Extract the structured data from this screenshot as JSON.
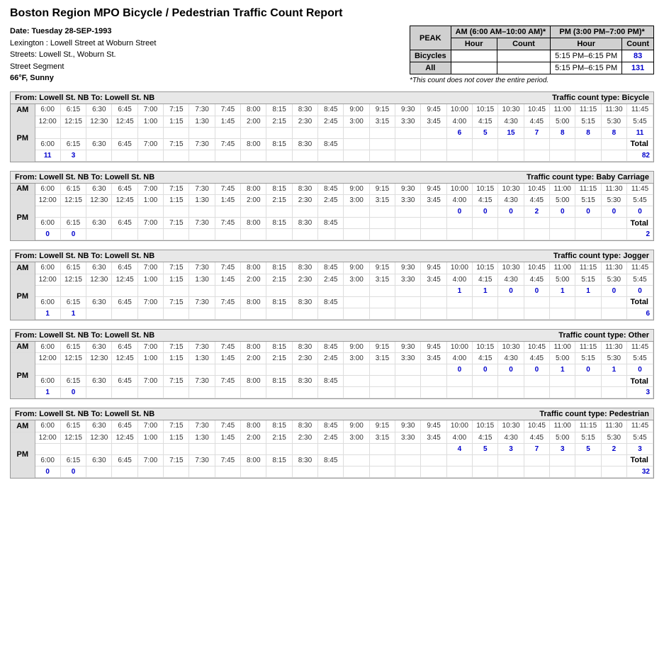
{
  "title": "Boston Region MPO Bicycle / Pedestrian Traffic Count Report",
  "header": {
    "date_label": "Date: Tuesday 28-SEP-1993",
    "location1": "Lexington : Lowell Street at Woburn Street",
    "location2": "Streets: Lowell St., Woburn St.",
    "segment": "Street Segment",
    "weather": "66°F, Sunny",
    "peak_label": "PEAK",
    "am_period": "AM (6:00 AM–10:00 AM)*",
    "pm_period": "PM (3:00 PM–7:00 PM)*",
    "hour_label": "Hour",
    "count_label": "Count",
    "bicycles_label": "Bicycles",
    "all_label": "All",
    "am_hour": "",
    "am_count": "",
    "pm_hour_bicycles": "5:15 PM–6:15 PM",
    "pm_count_bicycles": "83",
    "pm_hour_all": "5:15 PM–6:15 PM",
    "pm_count_all": "131",
    "note": "*This count does not cover the entire period."
  },
  "sections": [
    {
      "from": "From:   Lowell St. NB",
      "to": "To:   Lowell St. NB",
      "type": "Traffic count type:   Bicycle",
      "am_times1": [
        "6:00",
        "6:15",
        "6:30",
        "6:45",
        "7:00",
        "7:15",
        "7:30",
        "7:45",
        "8:00",
        "8:15",
        "8:30",
        "8:45",
        "9:00",
        "9:15",
        "9:30",
        "9:45",
        "10:00",
        "10:15",
        "10:30",
        "10:45",
        "11:00",
        "11:15",
        "11:30",
        "11:45"
      ],
      "am_counts1": [
        "",
        "",
        "",
        "",
        "",
        "",
        "",
        "",
        "",
        "",
        "",
        "",
        "",
        "",
        "",
        "",
        "",
        "",
        "",
        "",
        "",
        "",
        "",
        ""
      ],
      "pm_times1": [
        "12:00",
        "12:15",
        "12:30",
        "12:45",
        "1:00",
        "1:15",
        "1:30",
        "1:45",
        "2:00",
        "2:15",
        "2:30",
        "2:45",
        "3:00",
        "3:15",
        "3:30",
        "3:45",
        "4:00",
        "4:15",
        "4:30",
        "4:45",
        "5:00",
        "5:15",
        "5:30",
        "5:45"
      ],
      "pm_counts1": [
        "",
        "",
        "",
        "",
        "",
        "",
        "",
        "",
        "",
        "",
        "",
        "",
        "",
        "",
        "",
        "",
        "6",
        "5",
        "15",
        "7",
        "8",
        "8",
        "8",
        "11"
      ],
      "pm_times2": [
        "6:00",
        "6:15",
        "6:30",
        "6:45",
        "7:00",
        "7:15",
        "7:30",
        "7:45",
        "8:00",
        "8:15",
        "8:30",
        "8:45"
      ],
      "pm_counts2": [
        "11",
        "3",
        "",
        "",
        "",
        "",
        "",
        "",
        "",
        "",
        "",
        ""
      ],
      "total": "82"
    },
    {
      "from": "From:   Lowell St. NB",
      "to": "To:   Lowell St. NB",
      "type": "Traffic count type:   Baby Carriage",
      "am_times1": [
        "6:00",
        "6:15",
        "6:30",
        "6:45",
        "7:00",
        "7:15",
        "7:30",
        "7:45",
        "8:00",
        "8:15",
        "8:30",
        "8:45",
        "9:00",
        "9:15",
        "9:30",
        "9:45",
        "10:00",
        "10:15",
        "10:30",
        "10:45",
        "11:00",
        "11:15",
        "11:30",
        "11:45"
      ],
      "am_counts1": [
        "",
        "",
        "",
        "",
        "",
        "",
        "",
        "",
        "",
        "",
        "",
        "",
        "",
        "",
        "",
        "",
        "",
        "",
        "",
        "",
        "",
        "",
        "",
        ""
      ],
      "pm_times1": [
        "12:00",
        "12:15",
        "12:30",
        "12:45",
        "1:00",
        "1:15",
        "1:30",
        "1:45",
        "2:00",
        "2:15",
        "2:30",
        "2:45",
        "3:00",
        "3:15",
        "3:30",
        "3:45",
        "4:00",
        "4:15",
        "4:30",
        "4:45",
        "5:00",
        "5:15",
        "5:30",
        "5:45"
      ],
      "pm_counts1": [
        "",
        "",
        "",
        "",
        "",
        "",
        "",
        "",
        "",
        "",
        "",
        "",
        "",
        "",
        "",
        "",
        "0",
        "0",
        "0",
        "2",
        "0",
        "0",
        "0",
        "0"
      ],
      "pm_times2": [
        "6:00",
        "6:15",
        "6:30",
        "6:45",
        "7:00",
        "7:15",
        "7:30",
        "7:45",
        "8:00",
        "8:15",
        "8:30",
        "8:45"
      ],
      "pm_counts2": [
        "0",
        "0",
        "",
        "",
        "",
        "",
        "",
        "",
        "",
        "",
        "",
        ""
      ],
      "total": "2"
    },
    {
      "from": "From:   Lowell St. NB",
      "to": "To:   Lowell St. NB",
      "type": "Traffic count type:   Jogger",
      "am_times1": [
        "6:00",
        "6:15",
        "6:30",
        "6:45",
        "7:00",
        "7:15",
        "7:30",
        "7:45",
        "8:00",
        "8:15",
        "8:30",
        "8:45",
        "9:00",
        "9:15",
        "9:30",
        "9:45",
        "10:00",
        "10:15",
        "10:30",
        "10:45",
        "11:00",
        "11:15",
        "11:30",
        "11:45"
      ],
      "am_counts1": [
        "",
        "",
        "",
        "",
        "",
        "",
        "",
        "",
        "",
        "",
        "",
        "",
        "",
        "",
        "",
        "",
        "",
        "",
        "",
        "",
        "",
        "",
        "",
        ""
      ],
      "pm_times1": [
        "12:00",
        "12:15",
        "12:30",
        "12:45",
        "1:00",
        "1:15",
        "1:30",
        "1:45",
        "2:00",
        "2:15",
        "2:30",
        "2:45",
        "3:00",
        "3:15",
        "3:30",
        "3:45",
        "4:00",
        "4:15",
        "4:30",
        "4:45",
        "5:00",
        "5:15",
        "5:30",
        "5:45"
      ],
      "pm_counts1": [
        "",
        "",
        "",
        "",
        "",
        "",
        "",
        "",
        "",
        "",
        "",
        "",
        "",
        "",
        "",
        "",
        "1",
        "1",
        "0",
        "0",
        "1",
        "1",
        "0",
        "0"
      ],
      "pm_times2": [
        "6:00",
        "6:15",
        "6:30",
        "6:45",
        "7:00",
        "7:15",
        "7:30",
        "7:45",
        "8:00",
        "8:15",
        "8:30",
        "8:45"
      ],
      "pm_counts2": [
        "1",
        "1",
        "",
        "",
        "",
        "",
        "",
        "",
        "",
        "",
        "",
        ""
      ],
      "total": "6"
    },
    {
      "from": "From:   Lowell St. NB",
      "to": "To:   Lowell St. NB",
      "type": "Traffic count type:   Other",
      "am_times1": [
        "6:00",
        "6:15",
        "6:30",
        "6:45",
        "7:00",
        "7:15",
        "7:30",
        "7:45",
        "8:00",
        "8:15",
        "8:30",
        "8:45",
        "9:00",
        "9:15",
        "9:30",
        "9:45",
        "10:00",
        "10:15",
        "10:30",
        "10:45",
        "11:00",
        "11:15",
        "11:30",
        "11:45"
      ],
      "am_counts1": [
        "",
        "",
        "",
        "",
        "",
        "",
        "",
        "",
        "",
        "",
        "",
        "",
        "",
        "",
        "",
        "",
        "",
        "",
        "",
        "",
        "",
        "",
        "",
        ""
      ],
      "pm_times1": [
        "12:00",
        "12:15",
        "12:30",
        "12:45",
        "1:00",
        "1:15",
        "1:30",
        "1:45",
        "2:00",
        "2:15",
        "2:30",
        "2:45",
        "3:00",
        "3:15",
        "3:30",
        "3:45",
        "4:00",
        "4:15",
        "4:30",
        "4:45",
        "5:00",
        "5:15",
        "5:30",
        "5:45"
      ],
      "pm_counts1": [
        "",
        "",
        "",
        "",
        "",
        "",
        "",
        "",
        "",
        "",
        "",
        "",
        "",
        "",
        "",
        "",
        "0",
        "0",
        "0",
        "0",
        "1",
        "0",
        "1",
        "0"
      ],
      "pm_times2": [
        "6:00",
        "6:15",
        "6:30",
        "6:45",
        "7:00",
        "7:15",
        "7:30",
        "7:45",
        "8:00",
        "8:15",
        "8:30",
        "8:45"
      ],
      "pm_counts2": [
        "1",
        "0",
        "",
        "",
        "",
        "",
        "",
        "",
        "",
        "",
        "",
        ""
      ],
      "total": "3"
    },
    {
      "from": "From:   Lowell St. NB",
      "to": "To:   Lowell St. NB",
      "type": "Traffic count type:   Pedestrian",
      "am_times1": [
        "6:00",
        "6:15",
        "6:30",
        "6:45",
        "7:00",
        "7:15",
        "7:30",
        "7:45",
        "8:00",
        "8:15",
        "8:30",
        "8:45",
        "9:00",
        "9:15",
        "9:30",
        "9:45",
        "10:00",
        "10:15",
        "10:30",
        "10:45",
        "11:00",
        "11:15",
        "11:30",
        "11:45"
      ],
      "am_counts1": [
        "",
        "",
        "",
        "",
        "",
        "",
        "",
        "",
        "",
        "",
        "",
        "",
        "",
        "",
        "",
        "",
        "",
        "",
        "",
        "",
        "",
        "",
        "",
        ""
      ],
      "pm_times1": [
        "12:00",
        "12:15",
        "12:30",
        "12:45",
        "1:00",
        "1:15",
        "1:30",
        "1:45",
        "2:00",
        "2:15",
        "2:30",
        "2:45",
        "3:00",
        "3:15",
        "3:30",
        "3:45",
        "4:00",
        "4:15",
        "4:30",
        "4:45",
        "5:00",
        "5:15",
        "5:30",
        "5:45"
      ],
      "pm_counts1": [
        "",
        "",
        "",
        "",
        "",
        "",
        "",
        "",
        "",
        "",
        "",
        "",
        "",
        "",
        "",
        "",
        "4",
        "5",
        "3",
        "7",
        "3",
        "5",
        "2",
        "3"
      ],
      "pm_times2": [
        "6:00",
        "6:15",
        "6:30",
        "6:45",
        "7:00",
        "7:15",
        "7:30",
        "7:45",
        "8:00",
        "8:15",
        "8:30",
        "8:45"
      ],
      "pm_counts2": [
        "0",
        "0",
        "",
        "",
        "",
        "",
        "",
        "",
        "",
        "",
        "",
        ""
      ],
      "total": "32"
    }
  ],
  "labels": {
    "am": "AM",
    "pm": "PM",
    "total": "Total"
  }
}
